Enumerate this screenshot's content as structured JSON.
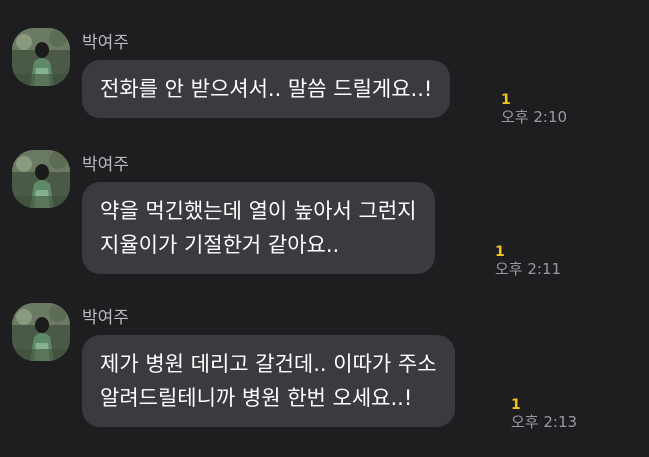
{
  "messages": [
    {
      "sender": "박여주",
      "lines": [
        "전화를 안 받으셔서.. 말씀 드릴게요..!"
      ],
      "unread": "1",
      "time": "오후 2:10"
    },
    {
      "sender": "박여주",
      "lines": [
        "약을 먹긴했는데 열이 높아서 그런지",
        "지율이가 기절한거 같아요.."
      ],
      "unread": "1",
      "time": "오후 2:11"
    },
    {
      "sender": "박여주",
      "lines": [
        "제가 병원 데리고 갈건데.. 이따가 주소",
        "알려드릴테니까 병원 한번 오세요..!"
      ],
      "unread": "1",
      "time": "오후 2:13"
    }
  ]
}
